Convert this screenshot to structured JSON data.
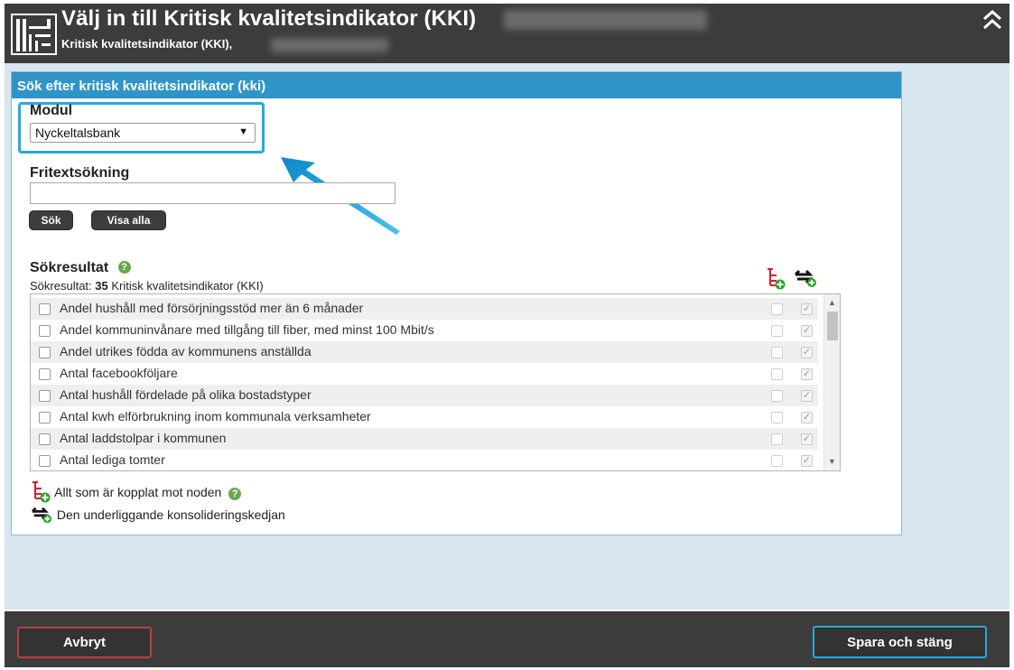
{
  "header": {
    "title": "Välj in till Kritisk kvalitetsindikator (KKI)",
    "subtitle": "Kritisk kvalitetsindikator (KKI),",
    "collapse_icon": "double-chevron-up-icon"
  },
  "panel": {
    "heading": "Sök efter kritisk kvalitetsindikator (kki)",
    "module": {
      "label": "Modul",
      "selected": "Nyckeltalsbank"
    },
    "freetext": {
      "label": "Fritextsökning",
      "value": ""
    },
    "buttons": {
      "search": "Sök",
      "show_all": "Visa alla"
    },
    "results": {
      "heading": "Sökresultat",
      "prefix": "Sökresultat:",
      "count": "35",
      "suffix": "Kritisk kvalitetsindikator (KKI)",
      "items": [
        "Andel hushåll med försörjningsstöd mer än 6 månader",
        "Andel kommuninvånare med tillgång till fiber, med minst 100 Mbit/s",
        "Andel utrikes födda av kommunens anställda",
        "Antal facebookföljare",
        "Antal hushåll fördelade på olika bostadstyper",
        "Antal kwh elförbrukning inom kommunala verksamheter",
        "Antal laddstolpar i kommunen",
        "Antal lediga tomter"
      ]
    },
    "legend": {
      "node": "Allt som är kopplat mot noden",
      "chain": "Den underliggande konsolideringskedjan"
    }
  },
  "footer": {
    "cancel": "Avbryt",
    "save": "Spara och stäng"
  },
  "colors": {
    "header_bg": "#3c3c3c",
    "panel_header": "#2f95c8",
    "highlight": "#29a8e0",
    "cancel_border": "#b5413f",
    "save_border": "#2ba7de"
  }
}
